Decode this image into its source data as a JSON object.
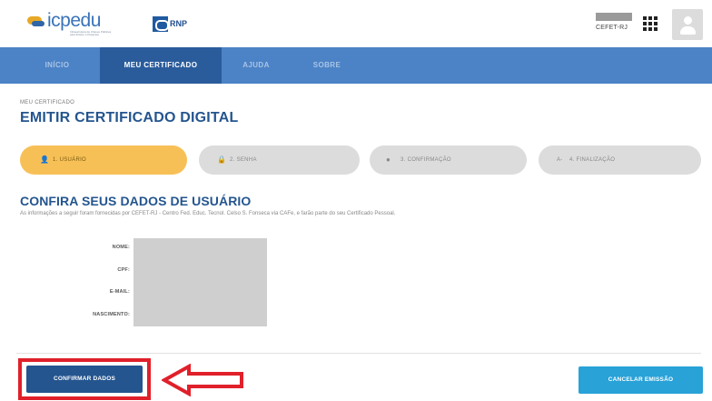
{
  "header": {
    "logo_text": "icpedu",
    "logo_tagline": "Infraestrutura de Chaves Públicas para Ensino e Pesquisa",
    "partner_logo_text": "RNP",
    "institution": "CEFET-RJ",
    "apps_icon": "grid-icon",
    "avatar_icon": "user-icon"
  },
  "nav": {
    "items": [
      {
        "label": "INÍCIO",
        "active": false
      },
      {
        "label": "MEU CERTIFICADO",
        "active": true
      },
      {
        "label": "AJUDA",
        "active": false
      },
      {
        "label": "SOBRE",
        "active": false
      }
    ]
  },
  "page": {
    "breadcrumb": "MEU CERTIFICADO",
    "title": "EMITIR CERTIFICADO DIGITAL"
  },
  "steps": [
    {
      "icon": "user-icon",
      "glyph": "👤",
      "label": "1. USUÁRIO",
      "active": true
    },
    {
      "icon": "lock-icon",
      "glyph": "🔒",
      "label": "2. SENHA",
      "active": false
    },
    {
      "icon": "check-circle-icon",
      "glyph": "●",
      "label": "3. CONFIRMAÇÃO",
      "active": false
    },
    {
      "icon": "finish-icon",
      "glyph": "A-",
      "label": "4. FINALIZAÇÃO",
      "active": false
    }
  ],
  "section": {
    "title": "CONFIRA SEUS DADOS DE USUÁRIO",
    "description": "As informações a seguir foram fornecidas por CEFET-RJ - Centro Fed. Educ. Tecnol. Celso S. Fonseca via CAFe, e farão parte do seu Certificado Pessoal."
  },
  "fields": [
    {
      "label": "NOME:"
    },
    {
      "label": "CPF:"
    },
    {
      "label": "E-MAIL:"
    },
    {
      "label": "NASCIMENTO:"
    }
  ],
  "actions": {
    "confirm_label": "CONFIRMAR DADOS",
    "cancel_label": "CANCELAR EMISSÃO"
  },
  "annotation": {
    "highlight_color": "#e0202a"
  },
  "colors": {
    "primary": "#24558f",
    "nav": "#4c83c6",
    "step_active": "#f7c057",
    "cancel": "#29a2d8"
  }
}
